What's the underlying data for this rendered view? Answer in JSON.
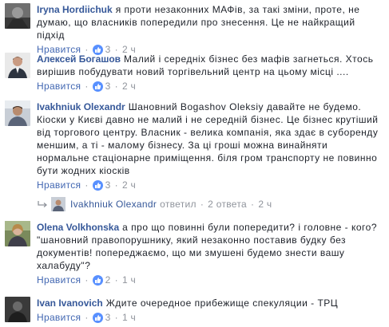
{
  "comments": [
    {
      "author": "Iryna Hordiichuk",
      "text": "я проти незаконних МАФів, за такі зміни, проте, не думаю, що власників попередили про знесення. Це не найкращий підхід",
      "like_label": "Нравится",
      "likes": "3",
      "time": "2 ч"
    },
    {
      "author": "Алексей Богашов",
      "text": "Малий і середніх бізнес без мафів загнеться. Хтось вирішив побудувати новий торгівельний центр на цьому місці ....",
      "like_label": "Нравится",
      "likes": "3",
      "time": "2 ч"
    },
    {
      "author": "Ivakhniuk Olexandr",
      "text": "Шановний Bogashov Oleksiy давайте не будемо. Кіоски у Києві давно не малий і не середній бізнес. Це бізнес крутіший від торгового центру. Власник - велика компанія, яка здає в суборенду меншим, а ті - малому бізнесу. За ці гроші можна винайняти нормальне стаціонарне приміщення. біля гром транспорту не повинно бути жодних кіосків",
      "like_label": "Нравится",
      "likes": "3",
      "time": "2 ч"
    },
    {
      "author": "Olena Volkhonska",
      "text": "а про що повинні були попередити? і головне - кого? \"шановний правопорушнику, який незаконно поставив будку без документів! попереджаємо, що ми змушені будемо знести вашу халабуду\"?",
      "like_label": "Нравится",
      "likes": "2",
      "time": "1 ч"
    },
    {
      "author": "Ivan Ivanovich",
      "text": "Ждите очередное прибежище спекуляции - ТРЦ",
      "like_label": "Нравится",
      "likes": "3",
      "time": "1 ч"
    }
  ],
  "replies_summary": {
    "author": "Ivakhniuk Olexandr",
    "action": "ответил",
    "count_text": "2 ответа",
    "time": "2 ч"
  },
  "colors": {
    "link": "#365899",
    "meta": "#90949c",
    "like_badge": "#5890ff",
    "like_text": "#4267b2"
  }
}
